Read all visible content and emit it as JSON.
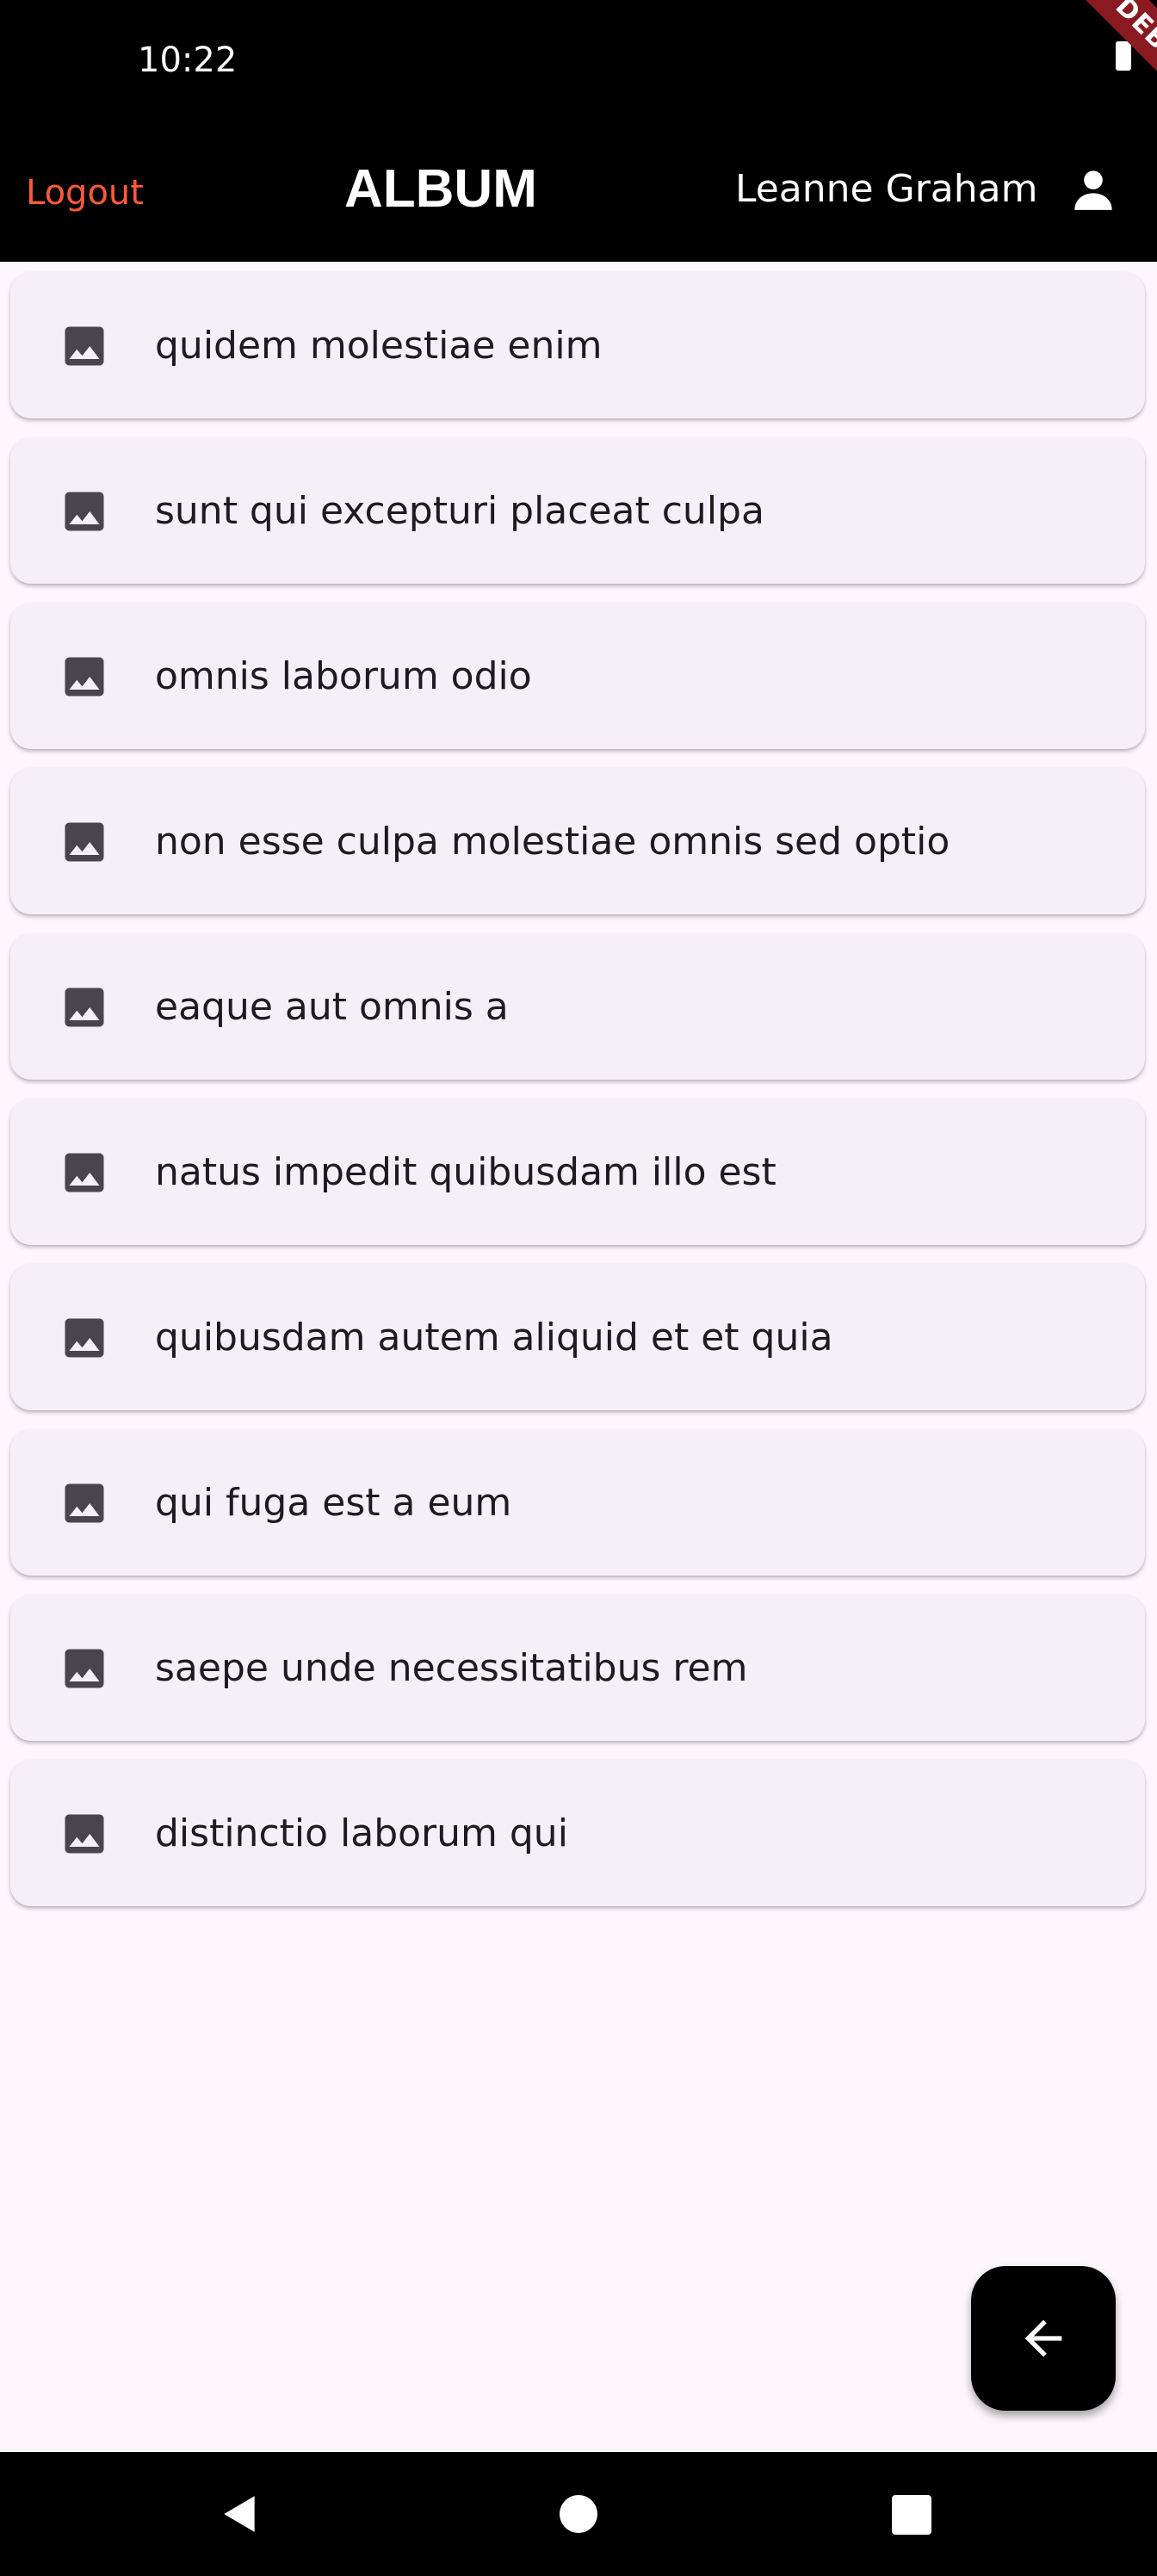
{
  "status_bar": {
    "time": "10:22",
    "battery_icon": "battery-icon"
  },
  "debug_banner": {
    "label": "DEBUG"
  },
  "app_bar": {
    "logout_label": "Logout",
    "title": "ALBUM",
    "user_name": "Leanne Graham",
    "user_icon": "person-icon",
    "colors": {
      "background": "#000000",
      "logout": "#ff5a36"
    }
  },
  "albums": [
    {
      "title": "quidem molestiae enim",
      "icon": "image-icon"
    },
    {
      "title": "sunt qui excepturi placeat culpa",
      "icon": "image-icon"
    },
    {
      "title": "omnis laborum odio",
      "icon": "image-icon"
    },
    {
      "title": "non esse culpa molestiae omnis sed optio",
      "icon": "image-icon"
    },
    {
      "title": "eaque aut omnis a",
      "icon": "image-icon"
    },
    {
      "title": "natus impedit quibusdam illo est",
      "icon": "image-icon"
    },
    {
      "title": "quibusdam autem aliquid et et quia",
      "icon": "image-icon"
    },
    {
      "title": "qui fuga est a eum",
      "icon": "image-icon"
    },
    {
      "title": "saepe unde necessitatibus rem",
      "icon": "image-icon"
    },
    {
      "title": "distinctio laborum qui",
      "icon": "image-icon"
    }
  ],
  "fab": {
    "icon": "arrow-back-icon"
  },
  "nav_bar": {
    "back_icon": "nav-back-icon",
    "home_icon": "nav-home-icon",
    "recents_icon": "nav-recents-icon"
  }
}
